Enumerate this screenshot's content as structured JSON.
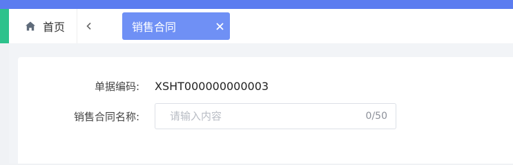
{
  "tabs": {
    "home_label": "首页",
    "active_label": "销售合同"
  },
  "form": {
    "doc_no_label": "单据编码:",
    "doc_no_value": "XSHT000000000003",
    "name_label": "销售合同名称:",
    "name_placeholder": "请输入内容",
    "name_value": "",
    "name_counter": "0/50"
  },
  "colors": {
    "topbar": "#5b7cf0",
    "accent_strip": "#2dc28c",
    "active_tab": "#6f90f5"
  },
  "icons": {
    "home": "home-icon",
    "back": "chevron-left-icon",
    "close": "close-icon"
  }
}
